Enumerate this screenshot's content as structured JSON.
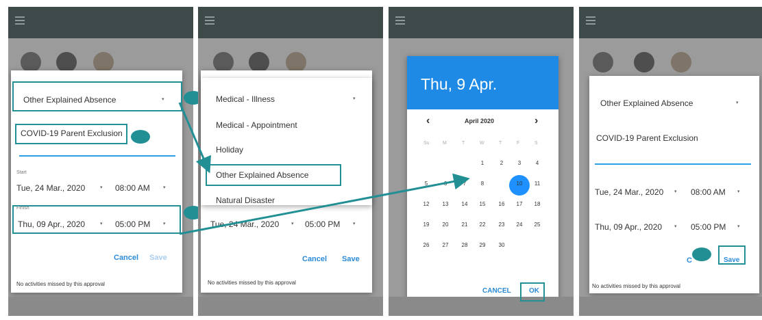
{
  "screens": [
    {
      "dropdown_value": "Other Explained Absence",
      "reason_text": "COVID-19 Parent Exclusion",
      "start_label": "Start",
      "start_date": "Tue, 24 Mar., 2020",
      "start_time": "08:00 AM",
      "end_label": "Finish",
      "end_date": "Thu, 09 Apr., 2020",
      "end_time": "05:00 PM",
      "cancel": "Cancel",
      "save": "Save",
      "note": "No activities missed by this approval"
    },
    {
      "menu_items": [
        "Medical - Illness",
        "Medical - Appointment",
        "Holiday",
        "Other Explained Absence",
        "Natural Disaster"
      ],
      "end_date": "Tue, 24 Mar., 2020",
      "end_time": "05:00 PM",
      "cancel": "Cancel",
      "save": "Save",
      "note": "No activities missed by this approval"
    },
    {
      "header_date": "Thu, 9 Apr.",
      "month_label": "April 2020",
      "prev": "‹",
      "next": "›",
      "dow": [
        "Su",
        "M",
        "T",
        "W",
        "T",
        "F",
        "S"
      ],
      "weeks": [
        [
          "",
          "",
          "",
          "1",
          "2",
          "3",
          "4"
        ],
        [
          "5",
          "6",
          "7",
          "8",
          "9",
          "10",
          "11"
        ],
        [
          "12",
          "13",
          "14",
          "15",
          "16",
          "17",
          "18"
        ],
        [
          "19",
          "20",
          "21",
          "22",
          "23",
          "24",
          "25"
        ],
        [
          "26",
          "27",
          "28",
          "29",
          "30",
          "",
          ""
        ]
      ],
      "selected_day": "9",
      "cancel": "CANCEL",
      "ok": "OK"
    },
    {
      "dropdown_value": "Other Explained Absence",
      "reason_text": "COVID-19 Parent Exclusion",
      "start_date": "Tue, 24 Mar., 2020",
      "start_time": "08:00 AM",
      "end_date": "Thu, 09 Apr., 2020",
      "end_time": "05:00 PM",
      "cancel": "C",
      "save": "Save",
      "note": "No activities missed by this approval"
    }
  ],
  "dropdown_arrow": "▾",
  "colors": {
    "teal": "#218f94",
    "blue": "#1e8ae6",
    "topbar": "#3e4a4a"
  }
}
